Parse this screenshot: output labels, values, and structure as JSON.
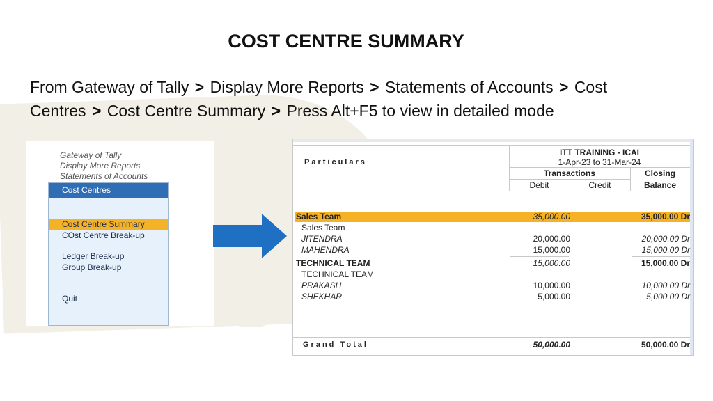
{
  "title": "COST CENTRE SUMMARY",
  "path": {
    "line1_part1": "From Gateway of Tally",
    "line1_part2": "Display More Reports",
    "line1_part3": "Statements of Accounts",
    "line1_part4": "Cost",
    "line2_part1": "Centres",
    "line2_part2": "Cost Centre Summary",
    "line2_part3": "Press Alt+F5 to view in detailed mode",
    "separator": ">"
  },
  "menu": {
    "breadcrumbs": [
      "Gateway of Tally",
      "Display More Reports",
      "Statements of Accounts"
    ],
    "box_title": "Cost Centres",
    "items": [
      {
        "label": "Cost Centre Summary",
        "highlighted": true
      },
      {
        "label": "COst Centre Break-up",
        "highlighted": false
      },
      {
        "label": "Ledger Break-up",
        "highlighted": false
      },
      {
        "label": "Group Break-up",
        "highlighted": false
      },
      {
        "label": "Quit",
        "highlighted": false
      }
    ],
    "highlight_color": "#f5b226",
    "title_bar_color": "#2f6eb5"
  },
  "arrow": {
    "icon": "right-arrow-icon",
    "color": "#1f6fc2"
  },
  "report": {
    "particulars_label": "Particulars",
    "company": "ITT TRAINING - ICAI",
    "period": "1-Apr-23 to 31-Mar-24",
    "transactions_label": "Transactions",
    "debit_label": "Debit",
    "credit_label": "Credit",
    "closing_label": "Closing",
    "balance_label": "Balance",
    "rows": [
      {
        "particular": "Sales Team",
        "debit": "35,000.00",
        "balance": "35,000.00 Dr"
      },
      {
        "particular": "Sales Team",
        "debit": "",
        "balance": ""
      },
      {
        "particular": "JITENDRA",
        "debit": "20,000.00",
        "balance": "20,000.00 Dr"
      },
      {
        "particular": "MAHENDRA",
        "debit": "15,000.00",
        "balance": "15,000.00 Dr"
      },
      {
        "particular": "TECHNICAL TEAM",
        "debit": "15,000.00",
        "balance": "15,000.00 Dr"
      },
      {
        "particular": "TECHNICAL TEAM",
        "debit": "",
        "balance": ""
      },
      {
        "particular": "PRAKASH",
        "debit": "10,000.00",
        "balance": "10,000.00 Dr"
      },
      {
        "particular": "SHEKHAR",
        "debit": "5,000.00",
        "balance": "5,000.00 Dr"
      }
    ],
    "grand_total_label": "Grand Total",
    "grand_total_debit": "50,000.00",
    "grand_total_balance": "50,000.00 Dr"
  }
}
